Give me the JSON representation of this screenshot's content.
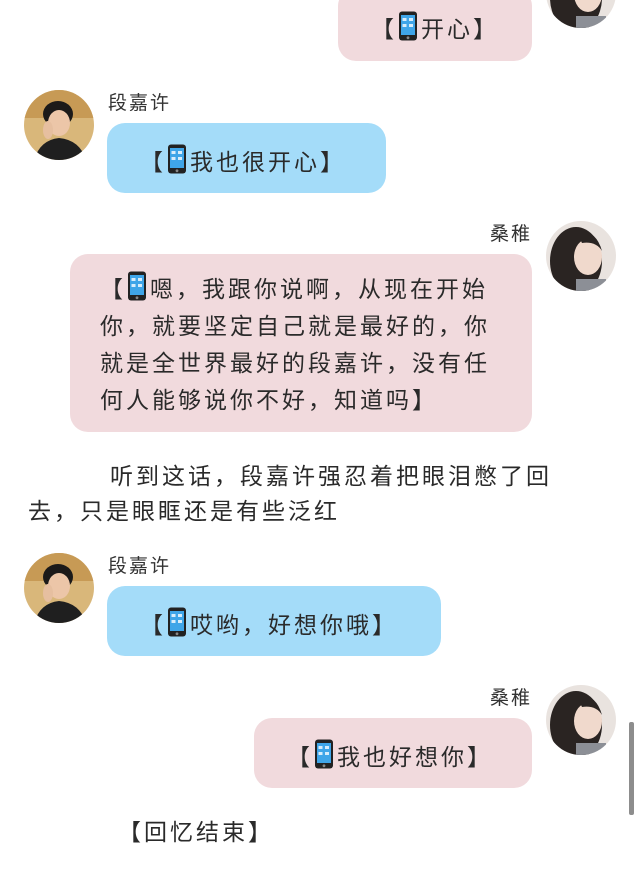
{
  "male_name": "段嘉许",
  "female_name": "桑稚",
  "colors": {
    "pink_bubble": "#f1dadd",
    "blue_bubble": "#a4dcf9"
  },
  "messages": [
    {
      "sender": "female",
      "open": "【",
      "text": "开心",
      "close": "】"
    },
    {
      "sender": "male",
      "open": "【",
      "text": "我也很开心",
      "close": "】"
    },
    {
      "sender": "female",
      "open": "【",
      "lines": [
        "嗯，我跟你说啊，从现在开始",
        "你，就要坚定自己就是最好的，你",
        "就是全世界最好的段嘉许，没有任",
        "何人能够说你不好，知道吗"
      ],
      "close": "】"
    },
    {
      "sender": "male",
      "open": "【",
      "text": "哎哟，好想你哦",
      "close": "】"
    },
    {
      "sender": "female",
      "open": "【",
      "text": "我也好想你",
      "close": "】"
    }
  ],
  "narration": {
    "line1": "听到这话，段嘉许强忍着把眼泪憋了回",
    "line2": "去，只是眼眶还是有些泛红"
  },
  "ending": "【回忆结束】",
  "icons": {
    "phone": "mobile-phone-icon",
    "male_avatar": "male-avatar",
    "female_avatar": "female-avatar"
  }
}
